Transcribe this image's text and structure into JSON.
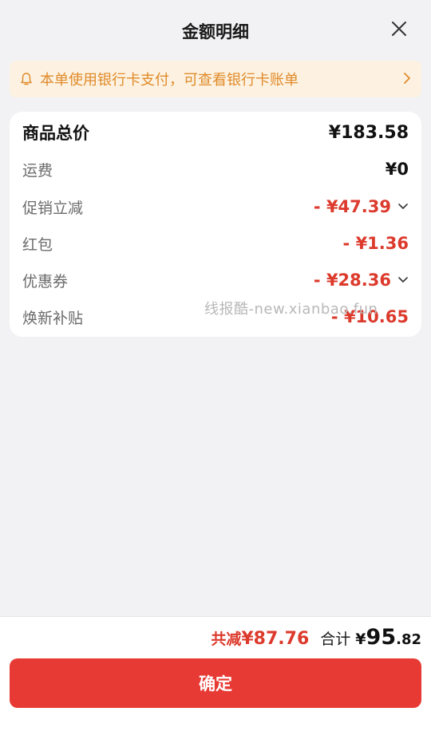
{
  "header": {
    "title": "金额明细"
  },
  "notice": {
    "text": "本单使用银行卡支付，可查看银行卡账单"
  },
  "details": {
    "rows": [
      {
        "label": "商品总价",
        "value": "¥183.58"
      },
      {
        "label": "运费",
        "value": "¥0"
      },
      {
        "label": "促销立减",
        "value": "- ¥47.39"
      },
      {
        "label": "红包",
        "value": "- ¥1.36"
      },
      {
        "label": "优惠券",
        "value": "- ¥28.36"
      },
      {
        "label": "焕新补贴",
        "value": "- ¥10.65"
      }
    ]
  },
  "watermark": "线报酷-new.xianbao.fun",
  "footer": {
    "saved_label": "共减",
    "saved_amount": "¥87.76",
    "total_label": "合计",
    "total_currency": "¥",
    "total_integer": "95",
    "total_decimal": ".82",
    "confirm_label": "确定"
  },
  "colors": {
    "accent": "#e83a34",
    "discount": "#dc3a2c",
    "notice_bg": "#fdf2e1",
    "notice_text": "#e08a2a"
  }
}
